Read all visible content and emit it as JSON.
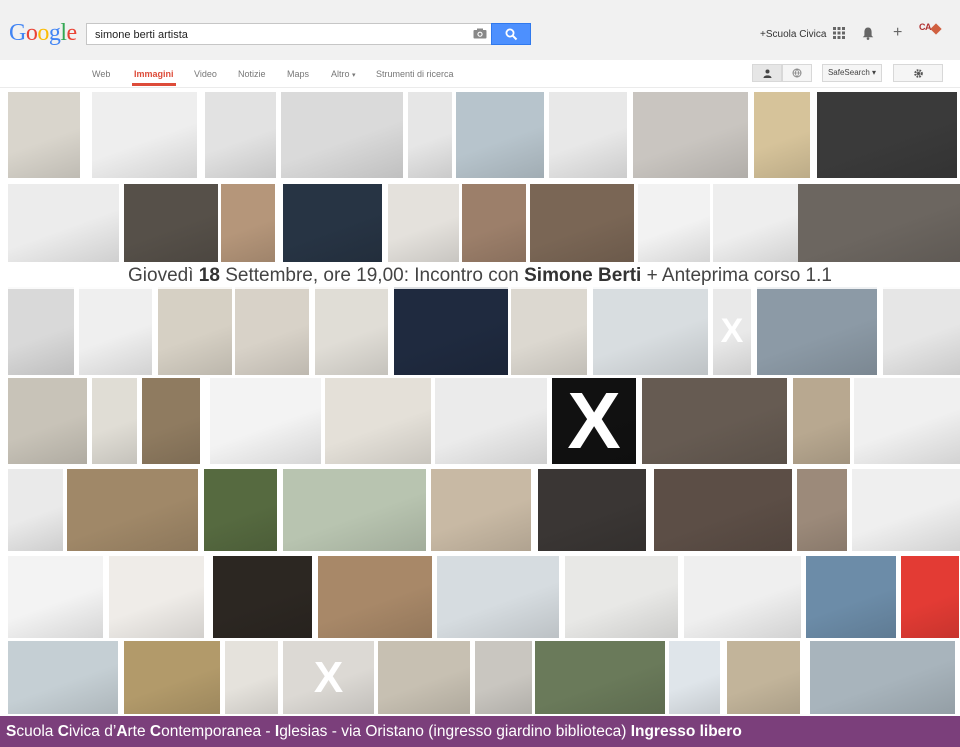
{
  "header": {
    "logo_text": "Google",
    "logo_colors": [
      "#4285f4",
      "#ea4335",
      "#fbbc05",
      "#4285f4",
      "#34a853",
      "#ea4335"
    ],
    "search_value": "simone berti artista",
    "account_link": "+Scuola Civica",
    "avatar_text": "CA"
  },
  "nav": {
    "items": [
      "Web",
      "Immagini",
      "Video",
      "Notizie",
      "Maps",
      "Altro",
      "Strumenti di ricerca"
    ],
    "active": "Immagini",
    "safesearch_label": "SafeSearch",
    "accent": "#dd4b39"
  },
  "banner": {
    "prefix": "Giovedì ",
    "day": "18",
    "mid": " Settembre, ore 19,00: Incontro con ",
    "name": "Simone Berti",
    "suffix": " + Anteprima corso 1.1"
  },
  "footer": {
    "s1": "S",
    "t1": "cuola ",
    "s2": "C",
    "t2": "ivica d’",
    "s3": "A",
    "t3": "rte ",
    "s4": "C",
    "t4": "ontemporanea - ",
    "s5": "I",
    "t5": "glesias",
    "t6": " - via Oristano (ingresso giardino biblioteca) ",
    "s6": "Ingresso libero",
    "background": "#7b3f7b"
  },
  "thumbnails": {
    "x_mark_text": "X",
    "rows": [
      {
        "colors": [
          "#d9d5cc",
          "#eeeeee",
          "#e2e2e2",
          "#dadada",
          "#e6e6e6",
          "#b7c4cc",
          "#e8e8e8",
          "#c9c5c0",
          "#d6c39a",
          "#3a3a3a"
        ]
      },
      {
        "colors": [
          "#ececec",
          "#565049",
          "#b5967a",
          "#273444",
          "#e4e1dc",
          "#9c7f6a",
          "#7a6655",
          "#f2f2f2",
          "#eeeeee",
          "#6c6660"
        ]
      },
      {
        "colors": [
          "#d9d9d9",
          "#efefef",
          "#d6d0c4",
          "#d8d2c8",
          "#e0ddd6",
          "#1f2a3f",
          "#dcd8d0",
          "#d8dde0",
          "#e9e9e9",
          "#8c9aa6",
          "#e6e6e6"
        ]
      },
      {
        "colors": [
          "#c8c3b8",
          "#e0ddd5",
          "#8f7b60",
          "#f3f3f3",
          "#e4e0d8",
          "#ebebeb",
          "#111111",
          "#665b52",
          "#b8a890",
          "#f0f0f0"
        ]
      },
      {
        "colors": [
          "#eaeaea",
          "#a08868",
          "#566a40",
          "#b8c4b0",
          "#c8b9a4",
          "#3a3634",
          "#5c4e46",
          "#9c8a7a",
          "#efefef"
        ]
      },
      {
        "colors": [
          "#f3f3f3",
          "#efece8",
          "#2c2722",
          "#a88868",
          "#d6dce0",
          "#e8e8e6",
          "#efefef",
          "#6c8ca8",
          "#e33b34"
        ]
      },
      {
        "colors": [
          "#c5cfd4",
          "#b29a6a",
          "#e5e2dc",
          "#dcd9d4",
          "#c7c0b2",
          "#c9c6c0",
          "#6a7a5a",
          "#dfe5ea",
          "#c2b49a",
          "#a8b4bc"
        ]
      }
    ]
  }
}
